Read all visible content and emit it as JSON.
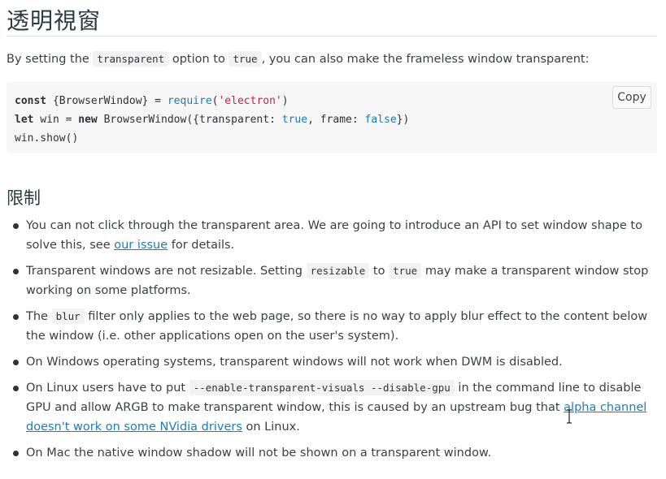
{
  "heading": "透明視窗",
  "intro": {
    "part1": "By setting the ",
    "code1": "transparent",
    "part2": " option to ",
    "code2": "true",
    "part3": ", you can also make the frameless window transparent:"
  },
  "code": {
    "line1": {
      "kw": "const",
      "a": " {BrowserWindow} = ",
      "fn": "require",
      "b": "(",
      "str": "'electron'",
      "c": ")"
    },
    "line2": {
      "kw1": "let",
      "a": " win = ",
      "kw2": "new",
      "b": " BrowserWindow({transparent: ",
      "lit1": "true",
      "c": ", frame: ",
      "lit2": "false",
      "d": "})"
    },
    "line3": "win.show()",
    "copy_label": "Copy"
  },
  "limits": {
    "heading": "限制",
    "items": [
      {
        "before": "You can not click through the transparent area. We are going to introduce an API to set window shape to solve this, see ",
        "link": "our issue",
        "after": " for details."
      },
      {
        "before": "Transparent windows are not resizable. Setting ",
        "code1": "resizable",
        "mid": " to ",
        "code2": "true",
        "after": " may make a transparent window stop working on some platforms."
      },
      {
        "before": "The ",
        "code1": "blur",
        "after": " filter only applies to the web page, so there is no way to apply blur effect to the content below the window (i.e. other applications open on the user's system)."
      },
      {
        "text": "On Windows operating systems, transparent windows will not work when DWM is disabled."
      },
      {
        "before": "On Linux users have to put ",
        "code1": "--enable-transparent-visuals --disable-gpu",
        "mid": " in the command line to disable GPU and allow ARGB to make transparent window, this is caused by an upstream bug that ",
        "link": "alpha channel doesn't work on some NVidia drivers",
        "after": " on Linux."
      },
      {
        "text": "On Mac the native window shadow will not be shown on a transparent window."
      }
    ]
  },
  "icons": {
    "cursor": "text-cursor-icon"
  }
}
